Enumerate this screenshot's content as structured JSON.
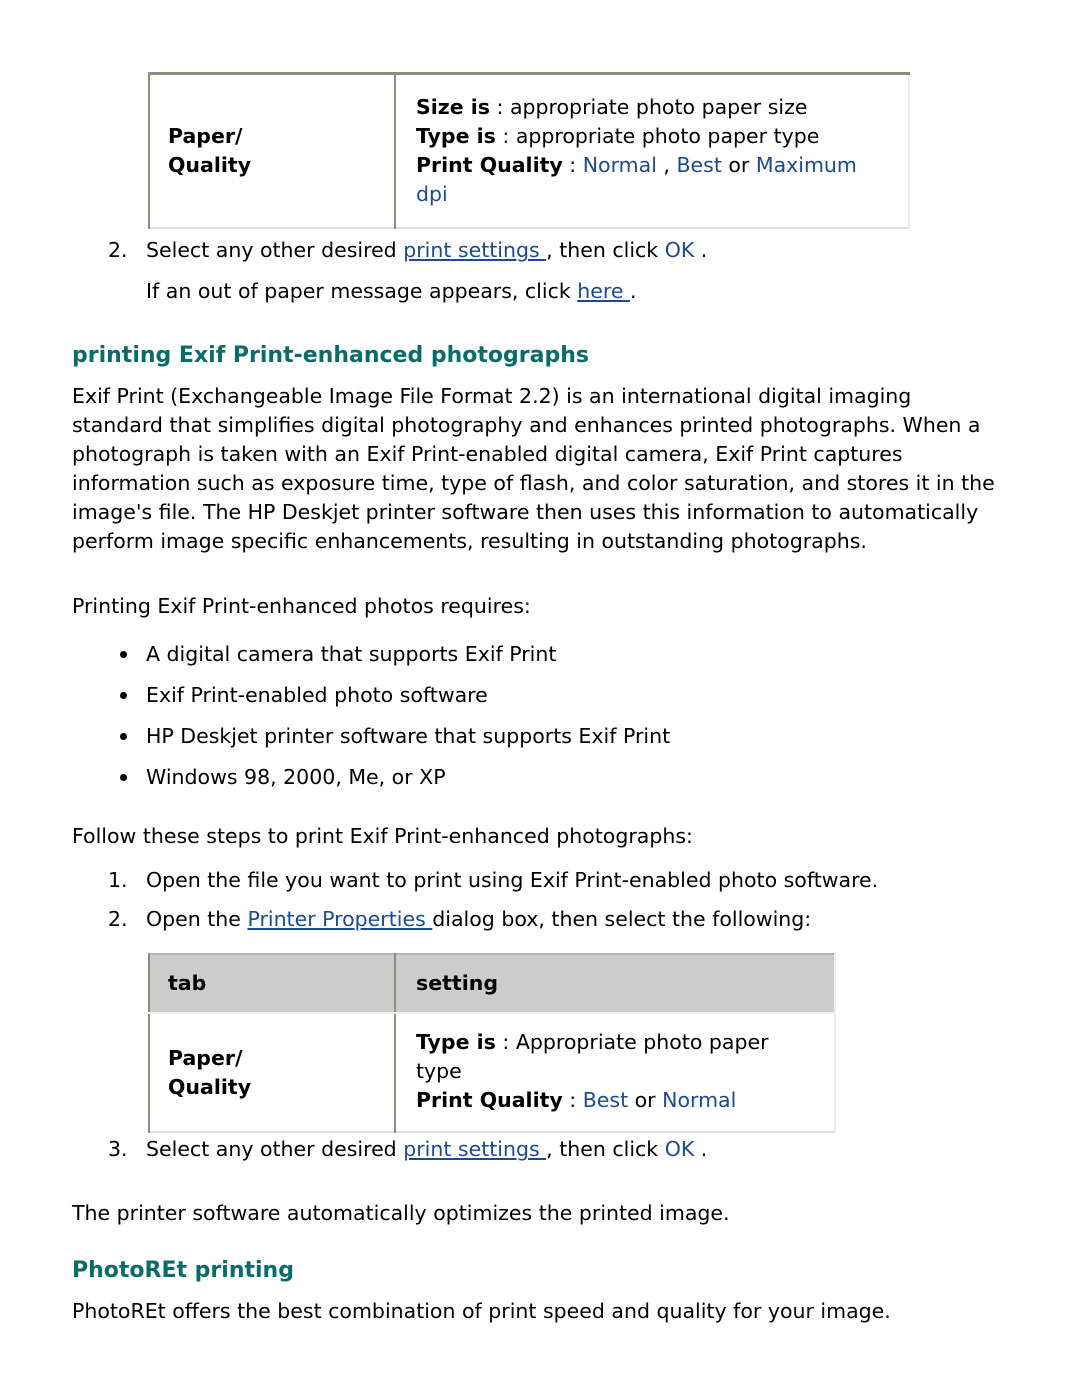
{
  "document": {
    "accent_heading_color": "#0a6b6b",
    "link_color": "#1a4a8f",
    "table_border_color": "#8d8d7e",
    "table_header_bg": "#cccccc"
  },
  "table_one": {
    "tab_label": "Paper/",
    "tab_label_2": "Quality",
    "rows": [
      {
        "bold": "Size is",
        "sep": " : ",
        "rest": "appropriate photo paper size"
      },
      {
        "bold": "Type is",
        "sep": " : ",
        "rest": "appropriate photo paper type"
      }
    ],
    "quality_row": {
      "bold": "Print Quality",
      "sep": " : ",
      "option_1": "Normal",
      "comma": " , ",
      "option_2": "Best",
      "or": " or ",
      "option_3": "Maximum",
      "option_3_wrap": "dpi"
    }
  },
  "step_2": {
    "marker": "2.",
    "text_before": "Select any other desired ",
    "link": "print settings ",
    "text_mid": ", then click ",
    "ok": "OK",
    "text_after": " .",
    "sub_before": "If an out of paper message appears, click ",
    "sub_link": "here ",
    "sub_after": "."
  },
  "section_exif": {
    "heading": "printing Exif Print-enhanced photographs",
    "paragraph": "Exif Print (Exchangeable Image File Format 2.2) is an international digital imaging standard that simplifies digital photography and enhances printed photographs. When a photograph is taken with an Exif Print-enabled digital camera, Exif Print captures information such as exposure time, type of flash, and color saturation, and stores it in the image's file. The HP Deskjet printer software then uses this information to automatically perform image specific enhancements, resulting in outstanding photographs.",
    "requires_intro": "Printing Exif Print-enhanced photos requires:",
    "requirements": [
      "A digital camera that supports Exif Print",
      "Exif Print-enabled photo software",
      "HP Deskjet printer software that supports Exif Print",
      "Windows 98, 2000, Me, or XP"
    ],
    "steps_intro": "Follow these steps to print Exif Print-enhanced photographs:",
    "steps": [
      {
        "marker": "1.",
        "text": "Open the file you want to print using Exif Print-enabled photo software."
      },
      {
        "marker": "2.",
        "text_before": "Open the ",
        "link": "Printer Properties ",
        "text_after": "dialog box, then select the following:"
      }
    ]
  },
  "table_two": {
    "header": {
      "tab": "tab",
      "setting": "setting"
    },
    "tab_label": "Paper/",
    "tab_label_2": "Quality",
    "type_row": {
      "bold": "Type is",
      "sep": " : ",
      "rest": "Appropriate photo paper",
      "rest_wrap": "type"
    },
    "quality_row": {
      "bold": "Print Quality",
      "sep": " : ",
      "option_1": "Best",
      "or": " or ",
      "option_2": "Normal"
    }
  },
  "step_3": {
    "marker": "3.",
    "text_before": "Select any other desired ",
    "link": "print settings ",
    "text_mid": ", then click ",
    "ok": "OK",
    "text_after": " ."
  },
  "closing": {
    "optimize_note": "The printer software automatically optimizes the printed image."
  },
  "section_photoret": {
    "heading": "PhotoREt printing",
    "paragraph": "PhotoREt offers the best combination of print speed and quality for your image."
  }
}
